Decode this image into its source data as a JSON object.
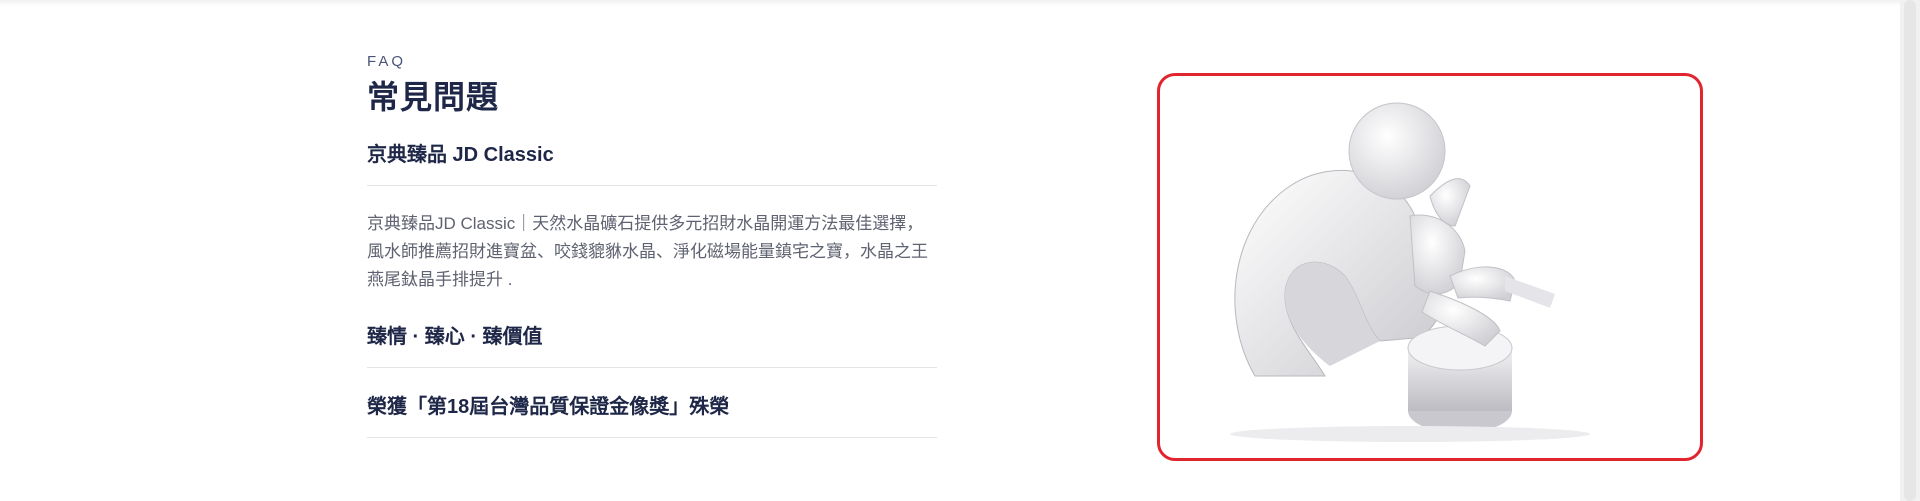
{
  "faq": {
    "eyebrow": "FAQ",
    "heading": "常見問題",
    "items": [
      {
        "title": "京典臻品 JD Classic",
        "answer": "京典臻品JD Classic｜天然水晶礦石提供多元招財水晶開運方法最佳選擇，風水師推薦招財進寶盆、咬錢貔貅水晶、淨化磁場能量鎮宅之寶，水晶之王燕尾鈦晶手排提升 ."
      },
      {
        "title": "臻情 · 臻心 · 臻價值"
      },
      {
        "title": "榮獲「第18屆台灣品質保證金像獎」殊榮"
      }
    ]
  },
  "image": {
    "icon": "thinking-figure-question-mark-icon"
  },
  "colors": {
    "accent_border": "#e0252f",
    "heading": "#1e2747",
    "body_text": "#5f6270"
  }
}
